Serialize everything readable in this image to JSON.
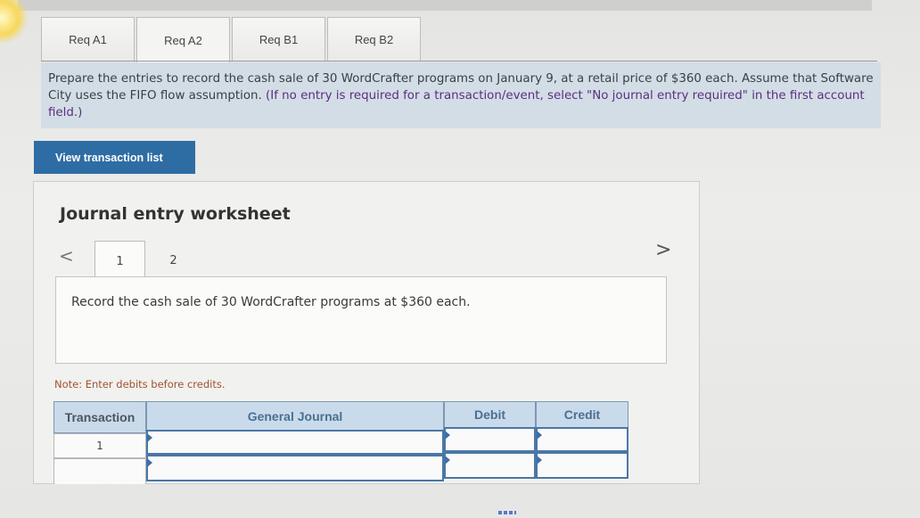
{
  "req_tabs": [
    "Req A1",
    "Req A2",
    "Req B1",
    "Req B2"
  ],
  "instructions": {
    "main": "Prepare the entries to record the cash sale of 30 WordCrafter programs on January 9, at a retail price of $360 each. Assume that Software City uses the FIFO flow assumption.",
    "hint": "(If no entry is required for a transaction/event, select \"No journal entry required\" in the first account field.)"
  },
  "buttons": {
    "view_transactions": "View transaction list"
  },
  "worksheet": {
    "title": "Journal entry worksheet",
    "nav_prev": "<",
    "nav_next": ">",
    "steps": [
      "1",
      "2"
    ],
    "record_text": "Record the cash sale of 30 WordCrafter programs at $360 each.",
    "note": "Note: Enter debits before credits."
  },
  "journal": {
    "headers": {
      "transaction": "Transaction",
      "general_journal": "General Journal",
      "debit": "Debit",
      "credit": "Credit"
    },
    "rows": [
      {
        "transaction": "1",
        "account": "",
        "debit": "",
        "credit": ""
      },
      {
        "transaction": "",
        "account": "",
        "debit": "",
        "credit": ""
      }
    ]
  },
  "colors": {
    "button_blue": "#2e6da4",
    "header_blue": "#c9dbea",
    "instruction_bg": "#d3dde5",
    "note_color": "#a0522d"
  }
}
